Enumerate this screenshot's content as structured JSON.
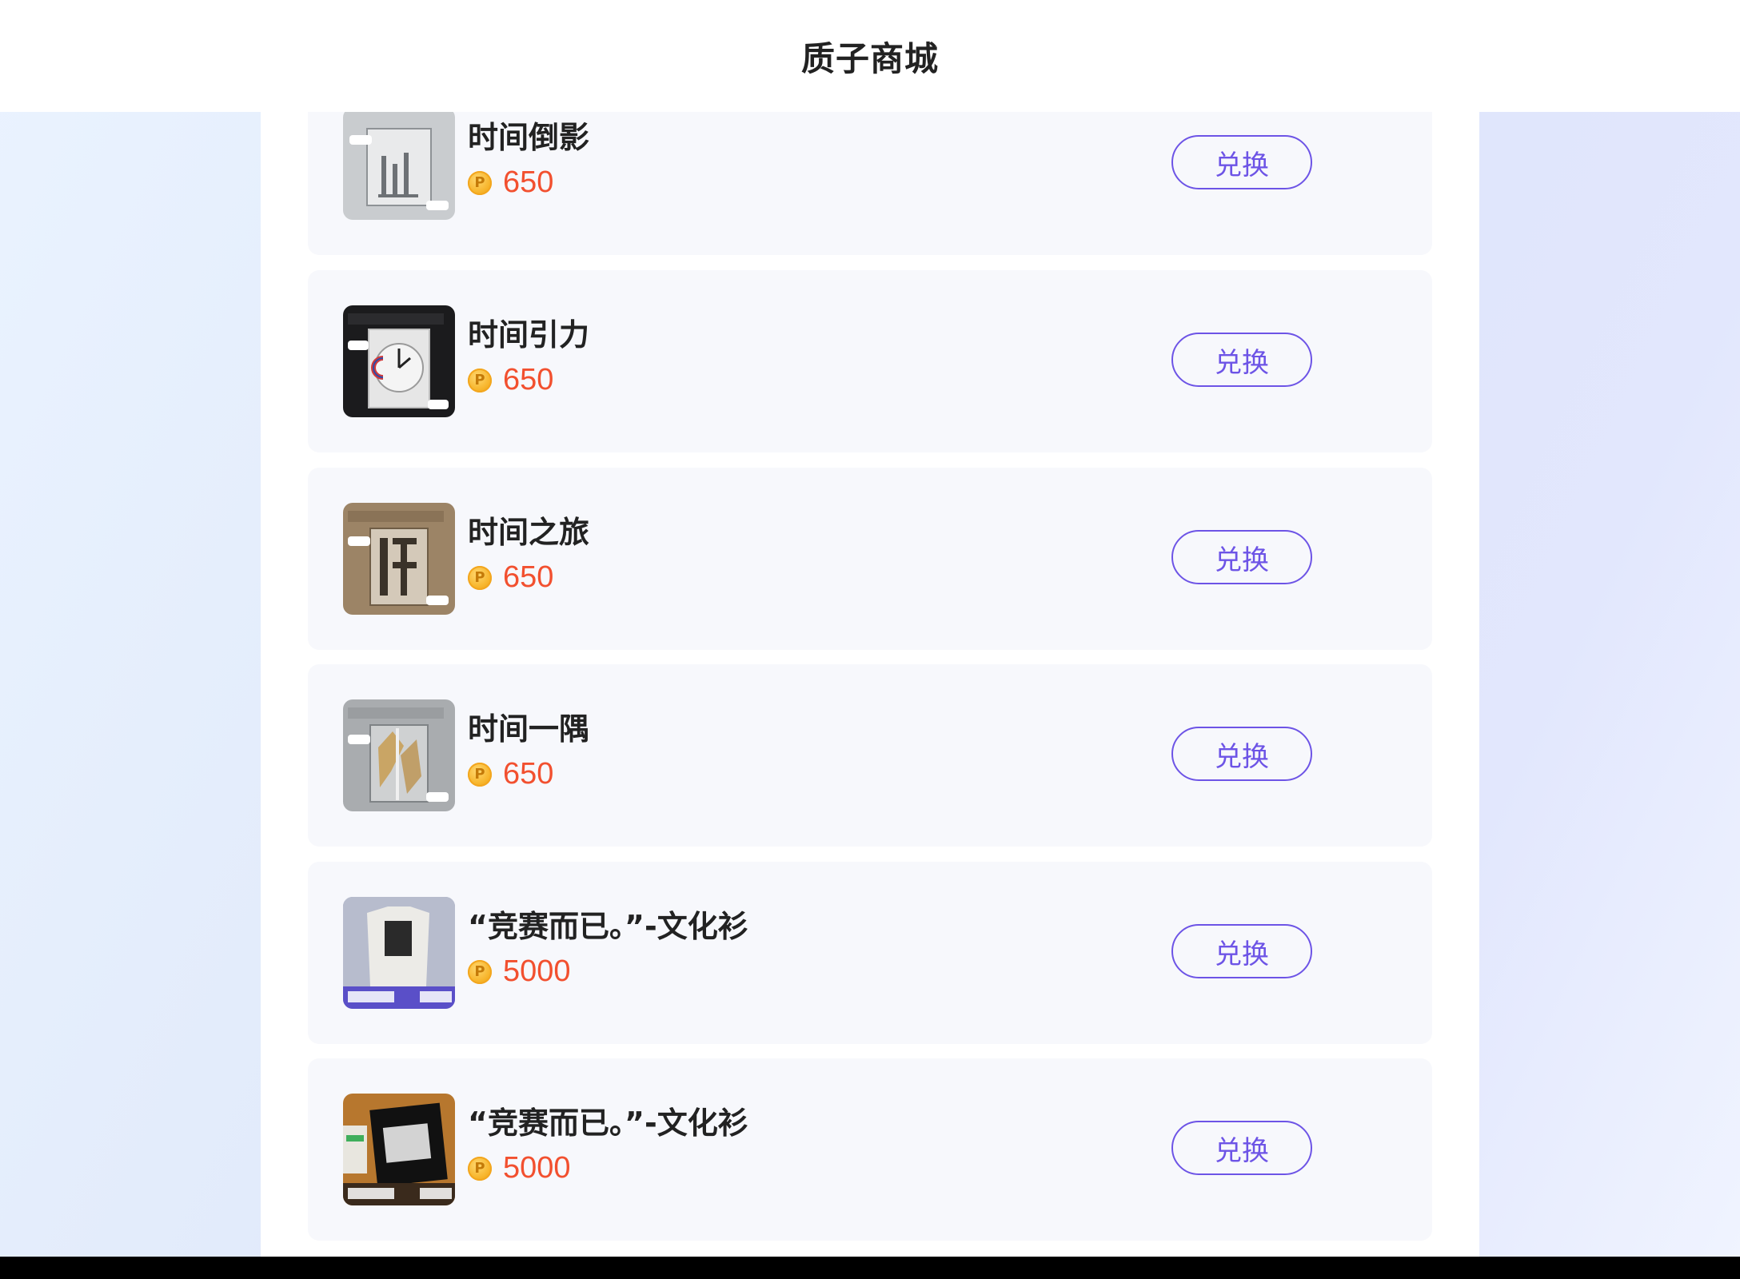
{
  "header": {
    "title": "质子商城"
  },
  "coin_symbol": "P",
  "exchange_label": "兑换",
  "items": [
    {
      "name": "时间倒影",
      "price": "650",
      "thumb": "light-gray"
    },
    {
      "name": "时间引力",
      "price": "650",
      "thumb": "dark-clock"
    },
    {
      "name": "时间之旅",
      "price": "650",
      "thumb": "brown"
    },
    {
      "name": "时间一隅",
      "price": "650",
      "thumb": "gray-gold"
    },
    {
      "name": "“竞赛而已。”-文化衫",
      "price": "5000",
      "thumb": "white-shirt"
    },
    {
      "name": "“竞赛而已。”-文化衫",
      "price": "5000",
      "thumb": "black-shirt"
    }
  ],
  "colors": {
    "accent": "#6d54e6",
    "price": "#f2502f",
    "card_bg": "#f7f8fc"
  }
}
